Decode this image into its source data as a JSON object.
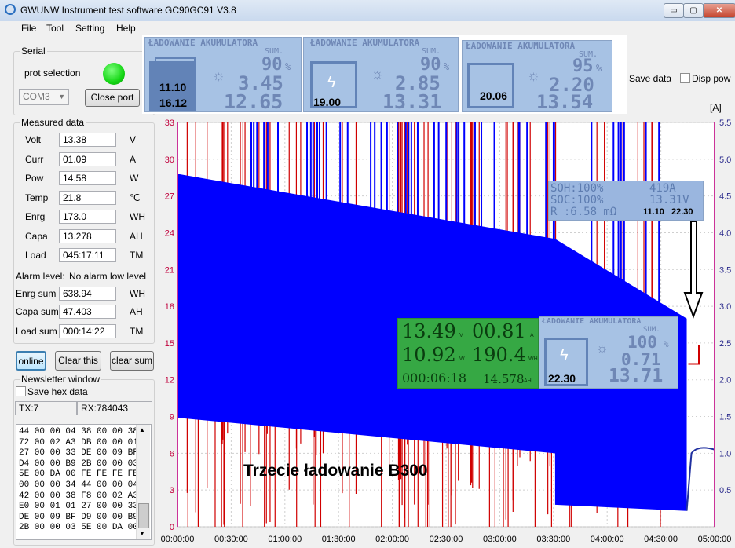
{
  "window": {
    "title": "GWUNW Instrument test software GC90GC91 V3.8",
    "minimize": "▭",
    "maximize": "▢",
    "close": "✕"
  },
  "menu": [
    "File",
    "Tool",
    "Setting",
    "Help"
  ],
  "serial": {
    "group_label": "Serial",
    "port_label": "prot selection",
    "port_value": "COM3",
    "close_port": "Close port",
    "status_color": "#14d614"
  },
  "measured": {
    "group_label": "Measured data",
    "rows": [
      {
        "label": "Volt",
        "value": "13.38",
        "unit": "V"
      },
      {
        "label": "Curr",
        "value": "01.09",
        "unit": "A"
      },
      {
        "label": "Pow",
        "value": "14.58",
        "unit": "W"
      },
      {
        "label": "Temp",
        "value": "21.8",
        "unit": "℃"
      },
      {
        "label": "Enrg",
        "value": "173.0",
        "unit": "WH"
      },
      {
        "label": "Capa",
        "value": "13.278",
        "unit": "AH"
      },
      {
        "label": "Load",
        "value": "045:17:11",
        "unit": "TM"
      }
    ],
    "alarm_label": "Alarm level:",
    "alarm_value": "No alarm low level",
    "sums": [
      {
        "label": "Enrg sum",
        "value": "638.94",
        "unit": "WH"
      },
      {
        "label": "Capa sum",
        "value": "47.403",
        "unit": "AH"
      },
      {
        "label": "Load sum",
        "value": "000:14:22",
        "unit": "TM"
      }
    ]
  },
  "buttons": {
    "online": "online",
    "clear_this": "Clear this",
    "clear_sum": "clear sum"
  },
  "newsletter": {
    "group_label": "Newsletter window",
    "save_hex": "Save hex data",
    "tx": "TX:7",
    "rx": "RX:784043",
    "hex_lines": [
      "44 00 00 04 38 00 00 38",
      "72 00 02 A3 DB 00 00 01",
      "27 00 00 33 DE 00 09 BF",
      "D4 00 00 B9 2B 00 00 03",
      "5E 00 DA 00 FE FE FE FE",
      "00 00 00 34 44 00 00 04",
      "42 00 00 38 F8 00 02 A3",
      "E0 00 01 01 27 00 00 33",
      "DE 00 09 BF D9 00 00 B9",
      "2B 00 00 03 5E 00 DA 00"
    ]
  },
  "top_options": {
    "save_data": "Save data",
    "disp_pow": "Disp pow"
  },
  "lcd_top": [
    {
      "header": "ŁADOWANIE AKUMULATORA",
      "sub": "SUM.",
      "pct": "90",
      "amp": "3.45",
      "volt": "12.65",
      "time1": "11.10",
      "time2": "16.12"
    },
    {
      "header": "ŁADOWANIE AKUMULATORA",
      "sub": "SUM.",
      "pct": "90",
      "amp": "2.85",
      "volt": "13.31",
      "time1": "19.00",
      "time2": ""
    },
    {
      "header": "ŁADOWANIE AKUMULATORA",
      "sub": "SUM.",
      "pct": "95",
      "amp": "2.20",
      "volt": "13.54",
      "time1": "20.06",
      "time2": ""
    }
  ],
  "lcd_soh": {
    "line1_a": "SOH:100%",
    "line1_b": "419A",
    "line2_a": "SOC:100%",
    "line2_b": "13.31V",
    "line3_a": "R  :6.58 mΩ",
    "time1": "11.10",
    "time2": "22.30"
  },
  "lcd_green": {
    "volt": "13.49",
    "volt_unit": "V",
    "amp": "00.81",
    "amp_unit": "A",
    "watt": "10.92",
    "watt_unit": "W",
    "wh": "190.4",
    "wh_unit": "WH",
    "time": "000:06:18",
    "ah": "14.578",
    "ah_unit": "AH"
  },
  "lcd_mid": {
    "header": "ŁADOWANIE AKUMULATORA",
    "sub": "SUM.",
    "pct": "100",
    "amp": "0.71",
    "volt": "13.71",
    "time": "22.30"
  },
  "chart_caption": "Trzecie ładowanie B300",
  "chart_data": {
    "type": "line",
    "ylabel_right": "[A]",
    "y_left_ticks": [
      "0",
      "3",
      "6",
      "9",
      "12",
      "15",
      "18",
      "21",
      "24",
      "27",
      "30",
      "33"
    ],
    "y_right_ticks": [
      "0.5",
      "1.0",
      "1.5",
      "2.0",
      "2.5",
      "3.0",
      "3.5",
      "4.0",
      "4.5",
      "5.0",
      "5.5"
    ],
    "x_ticks": [
      "00:00:00",
      "00:30:00",
      "01:00:00",
      "01:30:00",
      "02:00:00",
      "02:30:00",
      "03:00:00",
      "03:30:00",
      "04:00:00",
      "04:30:00",
      "05:00:00"
    ],
    "series": [
      {
        "name": "",
        "color": "#0000ff",
        "band": [
          {
            "t": 0,
            "low": 8.9,
            "high": 28.8
          },
          {
            "t": 3.5,
            "low": 6.0,
            "high": 23.5
          },
          {
            "t": 3.5,
            "low": 1.8,
            "high": 23.5
          },
          {
            "t": 4.72,
            "low": 1.3,
            "high": 17.0
          }
        ]
      },
      {
        "name": "",
        "color": "#ff0000",
        "note": "vertical spikes"
      }
    ],
    "ylim_left": [
      0,
      33
    ],
    "ylim_right": [
      0,
      5.5
    ]
  }
}
